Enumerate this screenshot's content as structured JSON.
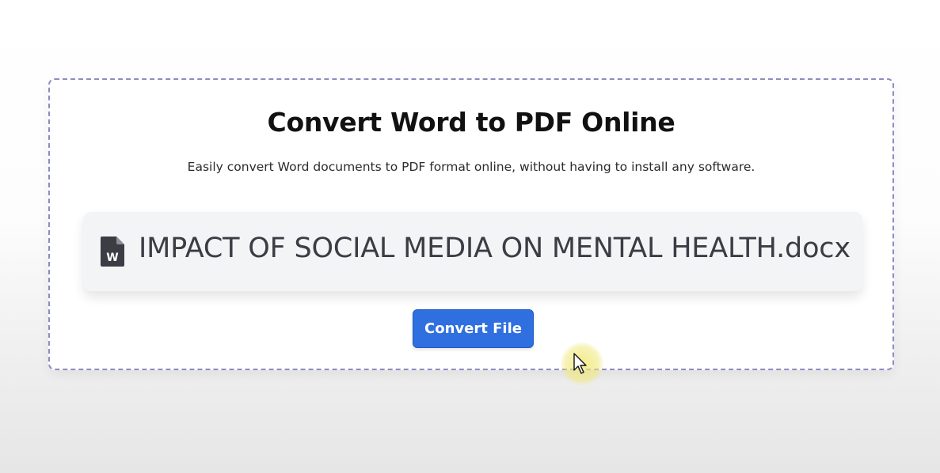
{
  "page": {
    "title": "Convert Word to PDF Online",
    "subtitle": "Easily convert Word documents to PDF format online, without having to install any software."
  },
  "file": {
    "name": "IMPACT OF SOCIAL MEDIA ON MENTAL HEALTH.docx",
    "icon": "word-file-icon",
    "icon_letter": "W"
  },
  "actions": {
    "convert_label": "Convert File"
  },
  "colors": {
    "accent": "#2f6fe0",
    "dashed_border": "#8c8cc4",
    "cursor_highlight": "#f0e878"
  }
}
